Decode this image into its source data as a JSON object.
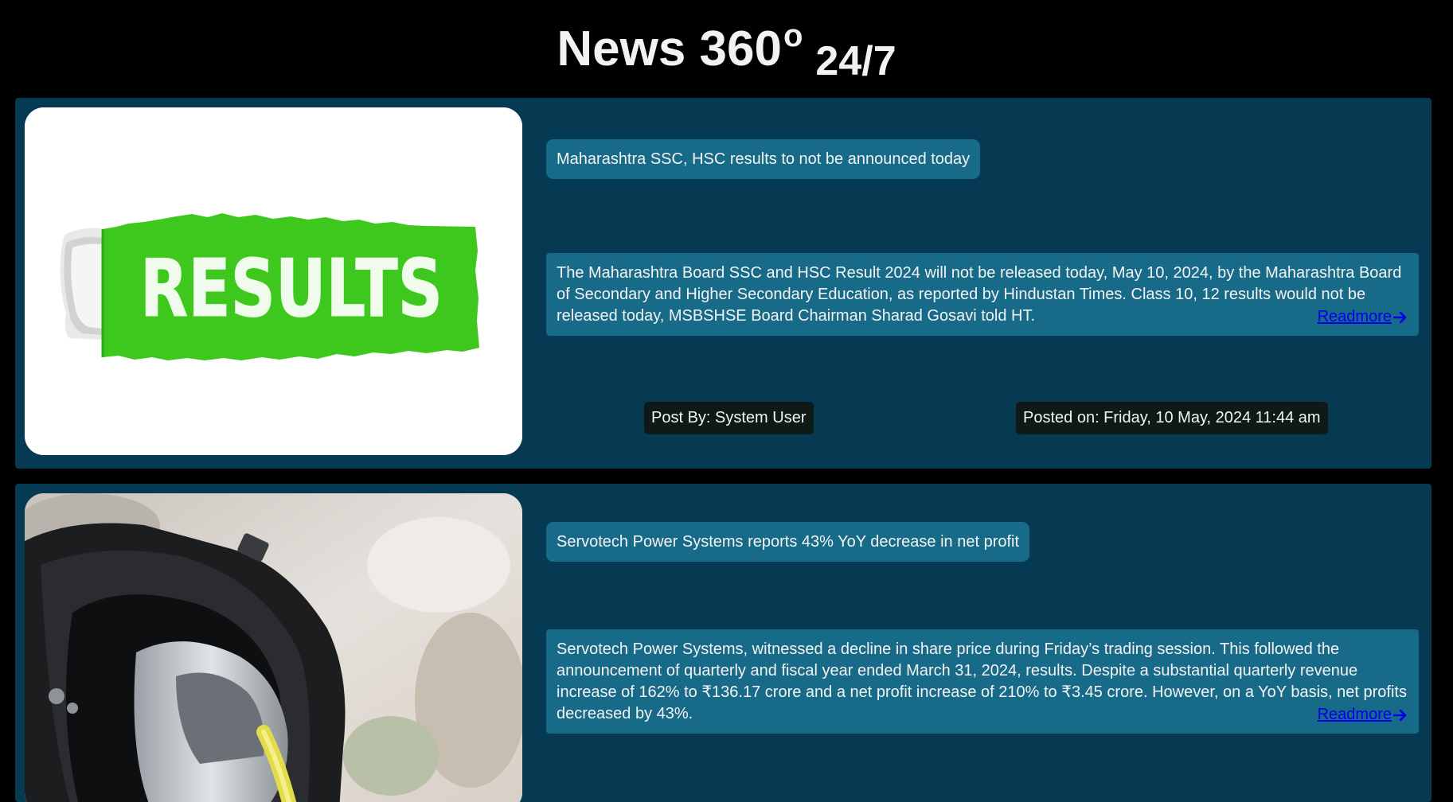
{
  "header": {
    "brand_main": "News 360",
    "brand_degree": "o",
    "brand_sub": "24/7"
  },
  "articles": [
    {
      "headline": "Maharashtra SSC, HSC results to not be announced today",
      "summary": "The Maharashtra Board SSC and HSC Result 2024 will not be released today, May 10, 2024, by the Maharashtra Board of Secondary and Higher Secondary Education, as reported by Hindustan Times. Class 10, 12 results would not be released today, MSBSHSE Board Chairman Sharad Gosavi told HT.",
      "readmore_label": "Readmore",
      "author": "Post By: System User",
      "posted_on": "Posted on: Friday, 10 May, 2024 11:44 am",
      "image_text": "RESULTS",
      "image_icon": "results-torn-paper-image"
    },
    {
      "headline": "Servotech Power Systems reports 43% YoY decrease in net profit",
      "summary": "Servotech Power Systems, witnessed a decline in share price during Friday’s trading session. This followed the announcement of quarterly and fiscal year ended March 31, 2024, results. Despite a substantial quarterly revenue increase of 162% to ₹136.17 crore and a net profit increase of 210% to ₹3.45 crore. However, on a YoY basis, net profits decreased by 43%.",
      "readmore_label": "Readmore",
      "image_icon": "ev-charger-plug-image"
    }
  ],
  "colors": {
    "page_bg": "#000000",
    "card_bg": "#063a52",
    "text_box_bg": "#176a88",
    "meta_bg": "#0d1a17",
    "link": "#0000ee",
    "results_green": "#3ec81e"
  }
}
